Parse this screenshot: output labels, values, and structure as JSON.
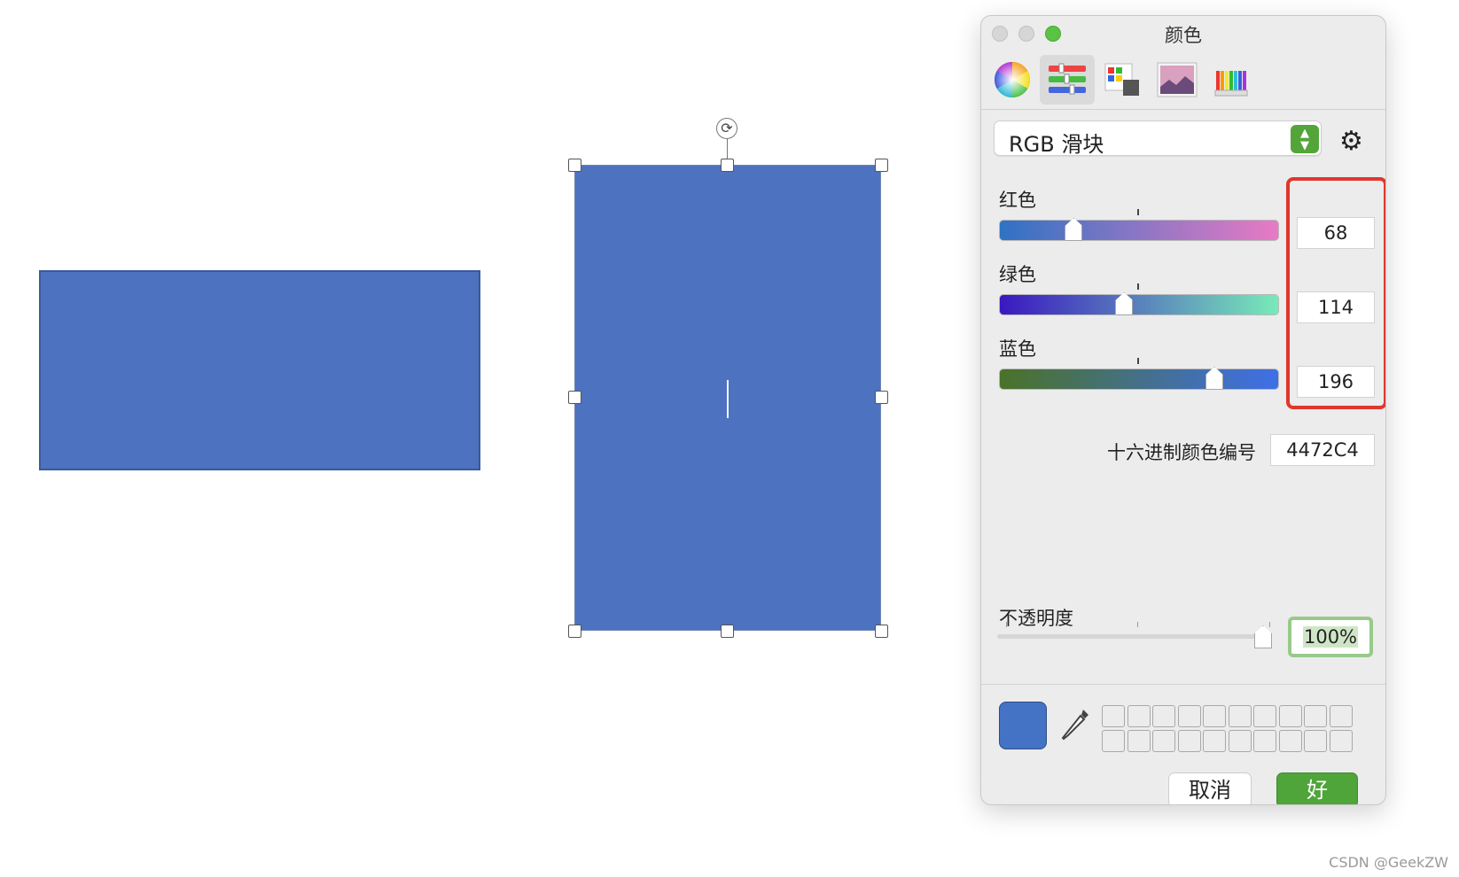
{
  "canvas": {
    "shape_fill": "#4d72bf"
  },
  "panel": {
    "title": "颜色",
    "modes": [
      {
        "name": "color-wheel-icon",
        "selected": false
      },
      {
        "name": "color-sliders-icon",
        "selected": true
      },
      {
        "name": "color-palettes-icon",
        "selected": false
      },
      {
        "name": "image-palettes-icon",
        "selected": false
      },
      {
        "name": "pencils-icon",
        "selected": false
      }
    ],
    "mode_select": {
      "label": "RGB 滑块"
    },
    "sliders": [
      {
        "key": "red",
        "label": "红色",
        "value": "68",
        "fraction": 0.267
      },
      {
        "key": "green",
        "label": "绿色",
        "value": "114",
        "fraction": 0.447
      },
      {
        "key": "blue",
        "label": "蓝色",
        "value": "196",
        "fraction": 0.769
      }
    ],
    "hex": {
      "label": "十六进制颜色编号",
      "value": "4472C4"
    },
    "opacity": {
      "label": "不透明度",
      "value": "100%",
      "fraction": 1.0
    },
    "current_color": "#4472C4",
    "buttons": {
      "cancel": "取消",
      "ok": "好"
    }
  },
  "watermark": "CSDN @GeekZW"
}
